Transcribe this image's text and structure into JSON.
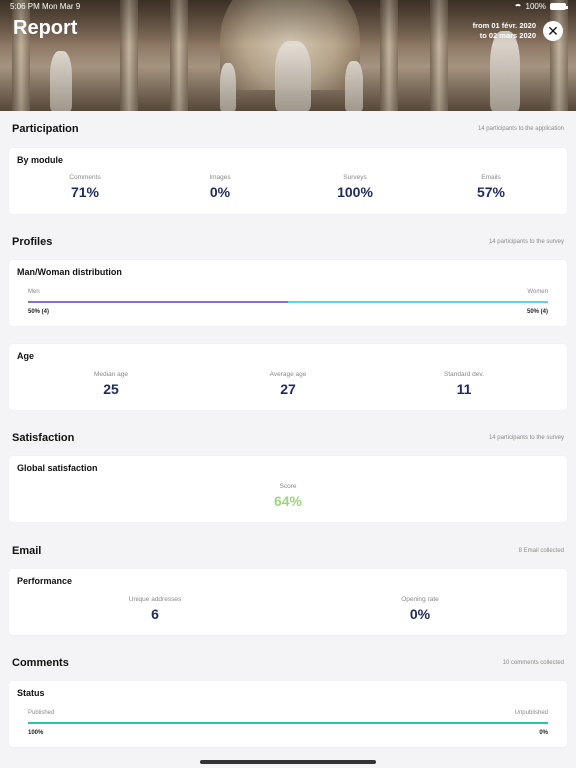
{
  "status_bar": {
    "time": "5:06 PM",
    "date": "Mon Mar 9",
    "battery": "100%"
  },
  "header": {
    "title": "Report",
    "range_line1": "from 01 févr. 2020",
    "range_line2": "to 02 mars 2020"
  },
  "participation": {
    "title": "Participation",
    "subtitle": "14 participants to the application",
    "card_title": "By module",
    "metrics": [
      {
        "label": "Comments",
        "value": "71%"
      },
      {
        "label": "Images",
        "value": "0%"
      },
      {
        "label": "Surveys",
        "value": "100%"
      },
      {
        "label": "Emails",
        "value": "57%"
      }
    ]
  },
  "profiles": {
    "title": "Profiles",
    "subtitle": "14 participants to the survey",
    "distribution": {
      "card_title": "Man/Woman distribution",
      "left_label": "Men",
      "right_label": "Women",
      "left_value": "50% (4)",
      "right_value": "50% (4)",
      "left_fraction": 0.5,
      "left_color": "#8a6fd1",
      "right_color": "#5fd3e6"
    },
    "age": {
      "card_title": "Age",
      "metrics": [
        {
          "label": "Median age",
          "value": "25"
        },
        {
          "label": "Average age",
          "value": "27"
        },
        {
          "label": "Standard dev.",
          "value": "11"
        }
      ]
    }
  },
  "satisfaction": {
    "title": "Satisfaction",
    "subtitle": "14 participants to the survey",
    "card_title": "Global satisfaction",
    "score_label": "Score",
    "score_value": "64%",
    "score_color": "#9ed67e"
  },
  "email": {
    "title": "Email",
    "subtitle": "8 Email collected",
    "card_title": "Performance",
    "metrics": [
      {
        "label": "Unique addresses",
        "value": "6"
      },
      {
        "label": "Opening rate",
        "value": "0%"
      }
    ]
  },
  "comments": {
    "title": "Comments",
    "subtitle": "10 comments collected",
    "card_title": "Status",
    "left_label": "Published",
    "right_label": "Unpublished",
    "left_value": "100%",
    "right_value": "0%",
    "left_fraction": 1.0,
    "left_color": "#2fc2a8"
  },
  "colors": {
    "accent_navy": "#1f2b5c",
    "background": "#f4f4f6"
  }
}
